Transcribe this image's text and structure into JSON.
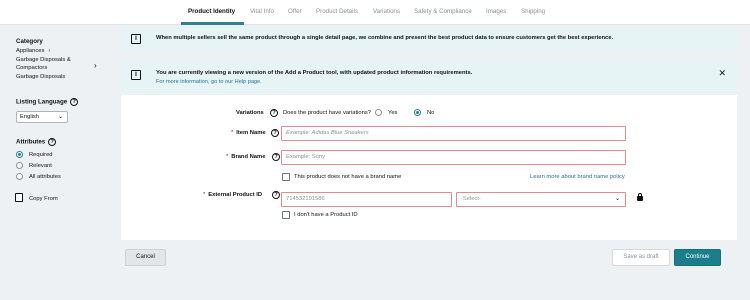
{
  "tabs": [
    {
      "label": "Product Identity",
      "active": true
    },
    {
      "label": "Vital Info",
      "active": false
    },
    {
      "label": "Offer",
      "active": false
    },
    {
      "label": "Product Details",
      "active": false
    },
    {
      "label": "Variations",
      "active": false
    },
    {
      "label": "Safety & Compliance",
      "active": false
    },
    {
      "label": "Images",
      "active": false
    },
    {
      "label": "Shipping",
      "active": false
    }
  ],
  "sidebar": {
    "category_heading": "Category",
    "category_path_1": "Appliances",
    "category_path_2": "Garbage Disposals &",
    "category_path_3": "Compactors",
    "category_path_4": "Garbage Disposals",
    "listing_language_heading": "Listing Language",
    "listing_language_value": "English",
    "attributes_heading": "Attributes",
    "attributes_options": [
      {
        "label": "Required",
        "selected": true
      },
      {
        "label": "Relevant",
        "selected": false
      },
      {
        "label": "All attributes",
        "selected": false
      }
    ],
    "copy_from_label": "Copy From"
  },
  "banners": {
    "banner1_text": "When multiple sellers sell the same product through a single detail page, we combine and present the best product data to ensure customers get the best experience.",
    "banner2_text": "You are currently viewing a new version of the Add a Product tool, with updated product information requirements.",
    "banner2_link": "For more information, go to our Help page."
  },
  "form": {
    "variations_label": "Variations",
    "variations_question": "Does the product have variations?",
    "variations_yes": "Yes",
    "variations_no": "No",
    "variations_selected": "No",
    "item_name_label": "Item Name",
    "item_name_placeholder": "Example: Adidas Blue Sneakers",
    "brand_name_label": "Brand Name",
    "brand_name_placeholder": "Example: Sony",
    "no_brand_checkbox": "This product does not have a brand name",
    "brand_policy_link": "Learn more about brand name policy",
    "external_id_label": "External Product ID",
    "external_id_value": "714532191586",
    "external_id_type": "-Select-",
    "no_product_id_checkbox": "I don't have a Product ID"
  },
  "buttons": {
    "cancel": "Cancel",
    "save_draft": "Save as draft",
    "continue": "Continue"
  },
  "colors": {
    "accent": "#2a8293",
    "continue_bg": "#1b7e8c",
    "banner_bg": "#e6f4f5",
    "required_border": "#e48c8c",
    "link": "#2a6f97"
  }
}
